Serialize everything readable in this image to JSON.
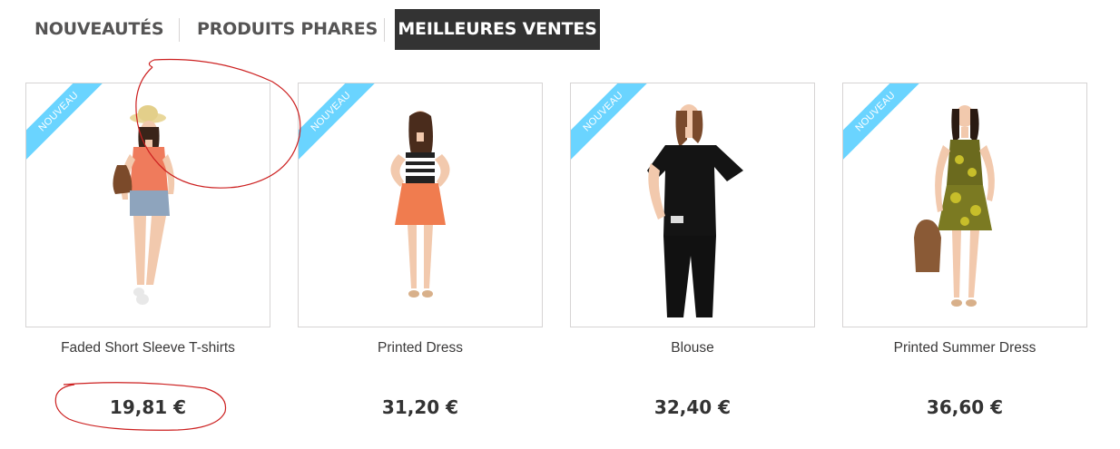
{
  "tabs": [
    {
      "label": "NOUVEAUTÉS",
      "active": false
    },
    {
      "label": "PRODUITS PHARES",
      "active": false
    },
    {
      "label": "MEILLEURES VENTES",
      "active": true
    }
  ],
  "badge_label": "NOUVEAU",
  "products": [
    {
      "name": "Faded Short Sleeve T-shirts",
      "price": "19,81 €",
      "badge": "NOUVEAU"
    },
    {
      "name": "Printed Dress",
      "price": "31,20 €",
      "badge": "NOUVEAU"
    },
    {
      "name": "Blouse",
      "price": "32,40 €",
      "badge": "NOUVEAU"
    },
    {
      "name": "Printed Summer Dress",
      "price": "36,60 €",
      "badge": "NOUVEAU"
    }
  ],
  "colors": {
    "active_tab_bg": "#333333",
    "badge": "#6ad4ff",
    "annotation": "#cc1f1f"
  }
}
